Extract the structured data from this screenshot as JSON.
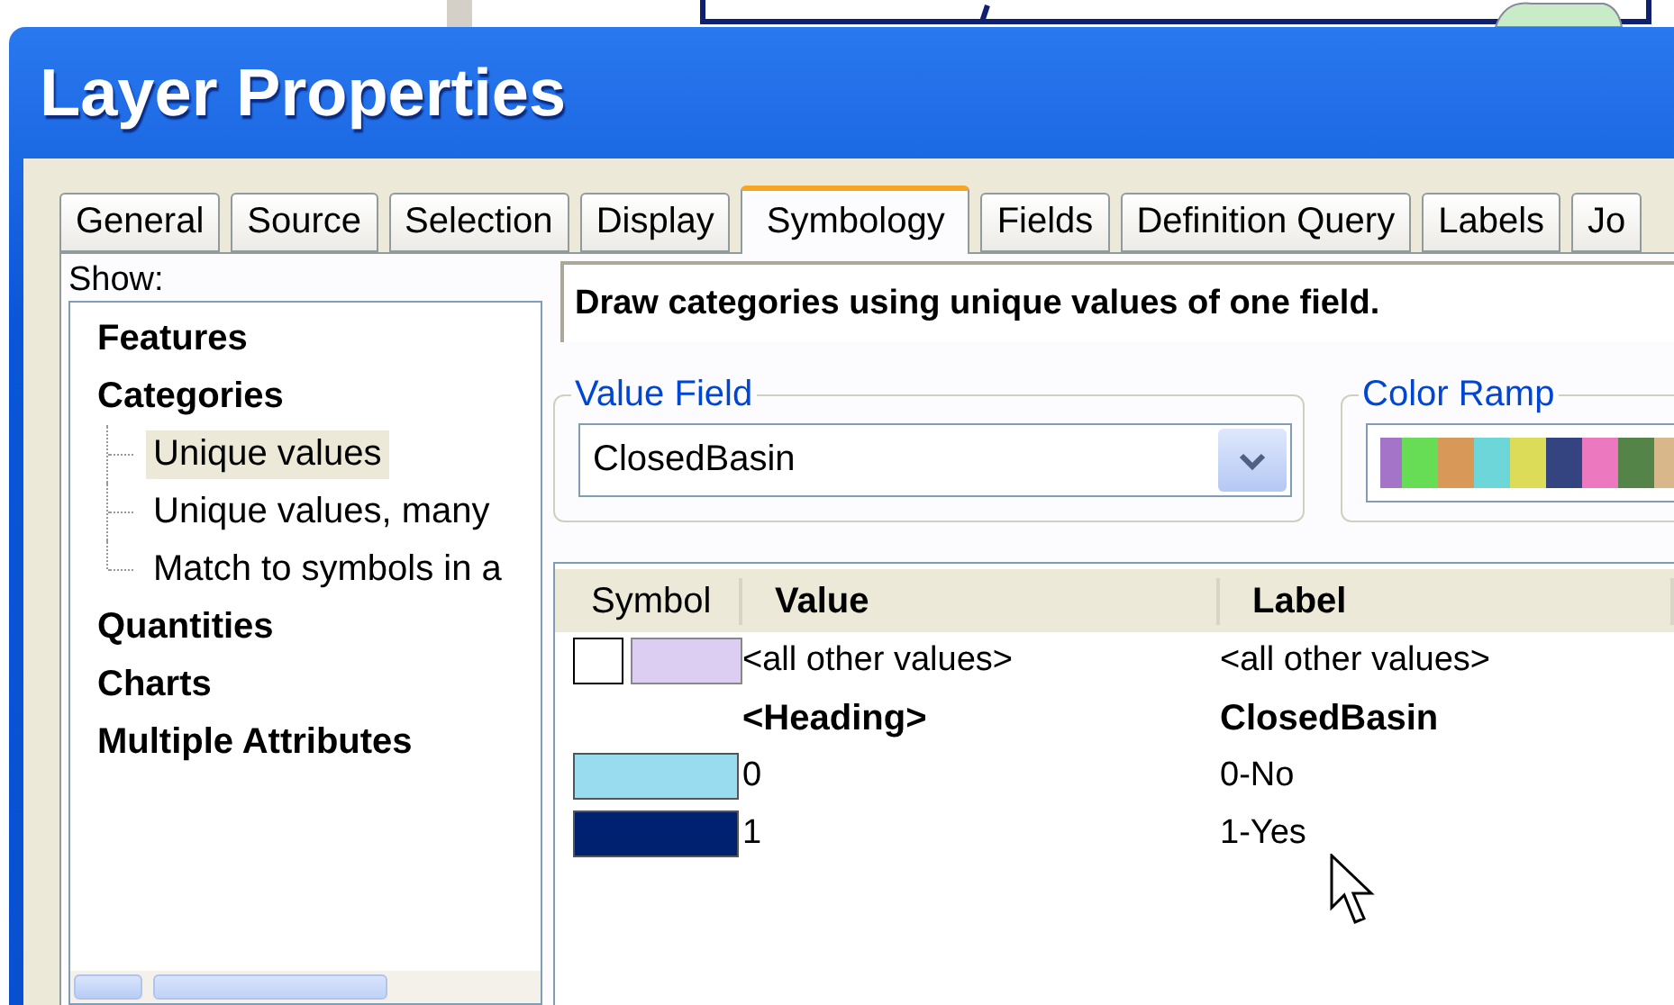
{
  "window": {
    "title": "Layer Properties"
  },
  "tabs": [
    {
      "label": "General",
      "selected": false
    },
    {
      "label": "Source",
      "selected": false
    },
    {
      "label": "Selection",
      "selected": false
    },
    {
      "label": "Display",
      "selected": false
    },
    {
      "label": "Symbology",
      "selected": true
    },
    {
      "label": "Fields",
      "selected": false
    },
    {
      "label": "Definition Query",
      "selected": false
    },
    {
      "label": "Labels",
      "selected": false
    },
    {
      "label": "Jo",
      "selected": false
    }
  ],
  "show": {
    "label": "Show:",
    "items": [
      {
        "label": "Features",
        "selected": false
      },
      {
        "label": "Categories",
        "selected": false,
        "children": [
          {
            "label": "Unique values",
            "selected": true
          },
          {
            "label": "Unique values, many",
            "selected": false
          },
          {
            "label": "Match to symbols in a",
            "selected": false
          }
        ]
      },
      {
        "label": "Quantities",
        "selected": false
      },
      {
        "label": "Charts",
        "selected": false
      },
      {
        "label": "Multiple Attributes",
        "selected": false
      }
    ]
  },
  "description": "Draw categories using unique values of one field.",
  "value_field": {
    "legend": "Value Field",
    "value": "ClosedBasin"
  },
  "color_ramp": {
    "legend": "Color Ramp",
    "swatches": [
      {
        "color": "#a474c8"
      },
      {
        "color": "#66dd55"
      },
      {
        "color": "#d89858"
      },
      {
        "color": "#6cd6d8"
      },
      {
        "color": "#dcdc58"
      },
      {
        "color": "#334480"
      },
      {
        "color": "#ec78c0"
      },
      {
        "color": "#558448"
      },
      {
        "color": "#d8b88a"
      }
    ]
  },
  "table": {
    "columns": [
      "Symbol",
      "Value",
      "Label"
    ],
    "rows": [
      {
        "kind": "other",
        "color": "#dccdf2",
        "value": "<all other values>",
        "label": "<all other values>"
      },
      {
        "kind": "heading",
        "value": "<Heading>",
        "label": "ClosedBasin"
      },
      {
        "kind": "class",
        "color": "#99dcf0",
        "value": "0",
        "label": "0-No"
      },
      {
        "kind": "class",
        "color": "#002070",
        "value": "1",
        "label": "1-Yes"
      }
    ]
  }
}
